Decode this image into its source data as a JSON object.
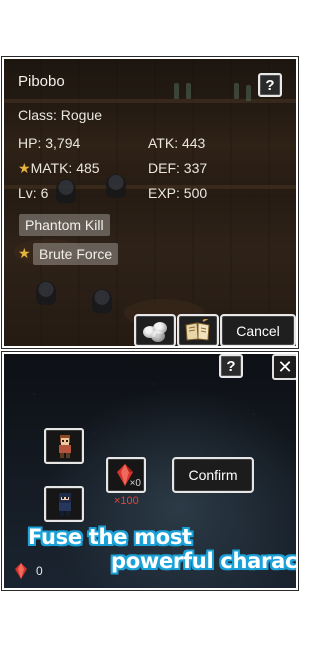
{
  "character": {
    "name": "Pibobo",
    "class_text": "Class: Rogue",
    "hp_text": "HP: 3,794",
    "atk_text": "ATK: 443",
    "matk_text": "MATK: 485",
    "def_text": "DEF: 337",
    "level_text": "Lv: 6",
    "exp_text": "EXP: 500",
    "star_glyph": "★"
  },
  "skills": [
    {
      "label": "Phantom Kill",
      "starred": false
    },
    {
      "label": "Brute Force",
      "starred": true
    }
  ],
  "top_actions": {
    "help_label": "?",
    "cancel_label": "Cancel",
    "item_buttons": [
      "pebbles-icon",
      "spellbook-icon"
    ]
  },
  "fusion": {
    "help_label": "?",
    "close_label": "✕",
    "gem_owned": "×0",
    "gem_required": "×100",
    "confirm_label": "Confirm",
    "total_gems": "0",
    "slots": [
      "warrior-portrait",
      "ninja-portrait"
    ]
  },
  "promo": {
    "line1": "Fuse the most",
    "line2": "powerful character"
  },
  "colors": {
    "star": "#e6b43c",
    "gem_red": "#d8322c",
    "promo_outline": "#1aa2d8",
    "required_red": "#e0463c"
  }
}
